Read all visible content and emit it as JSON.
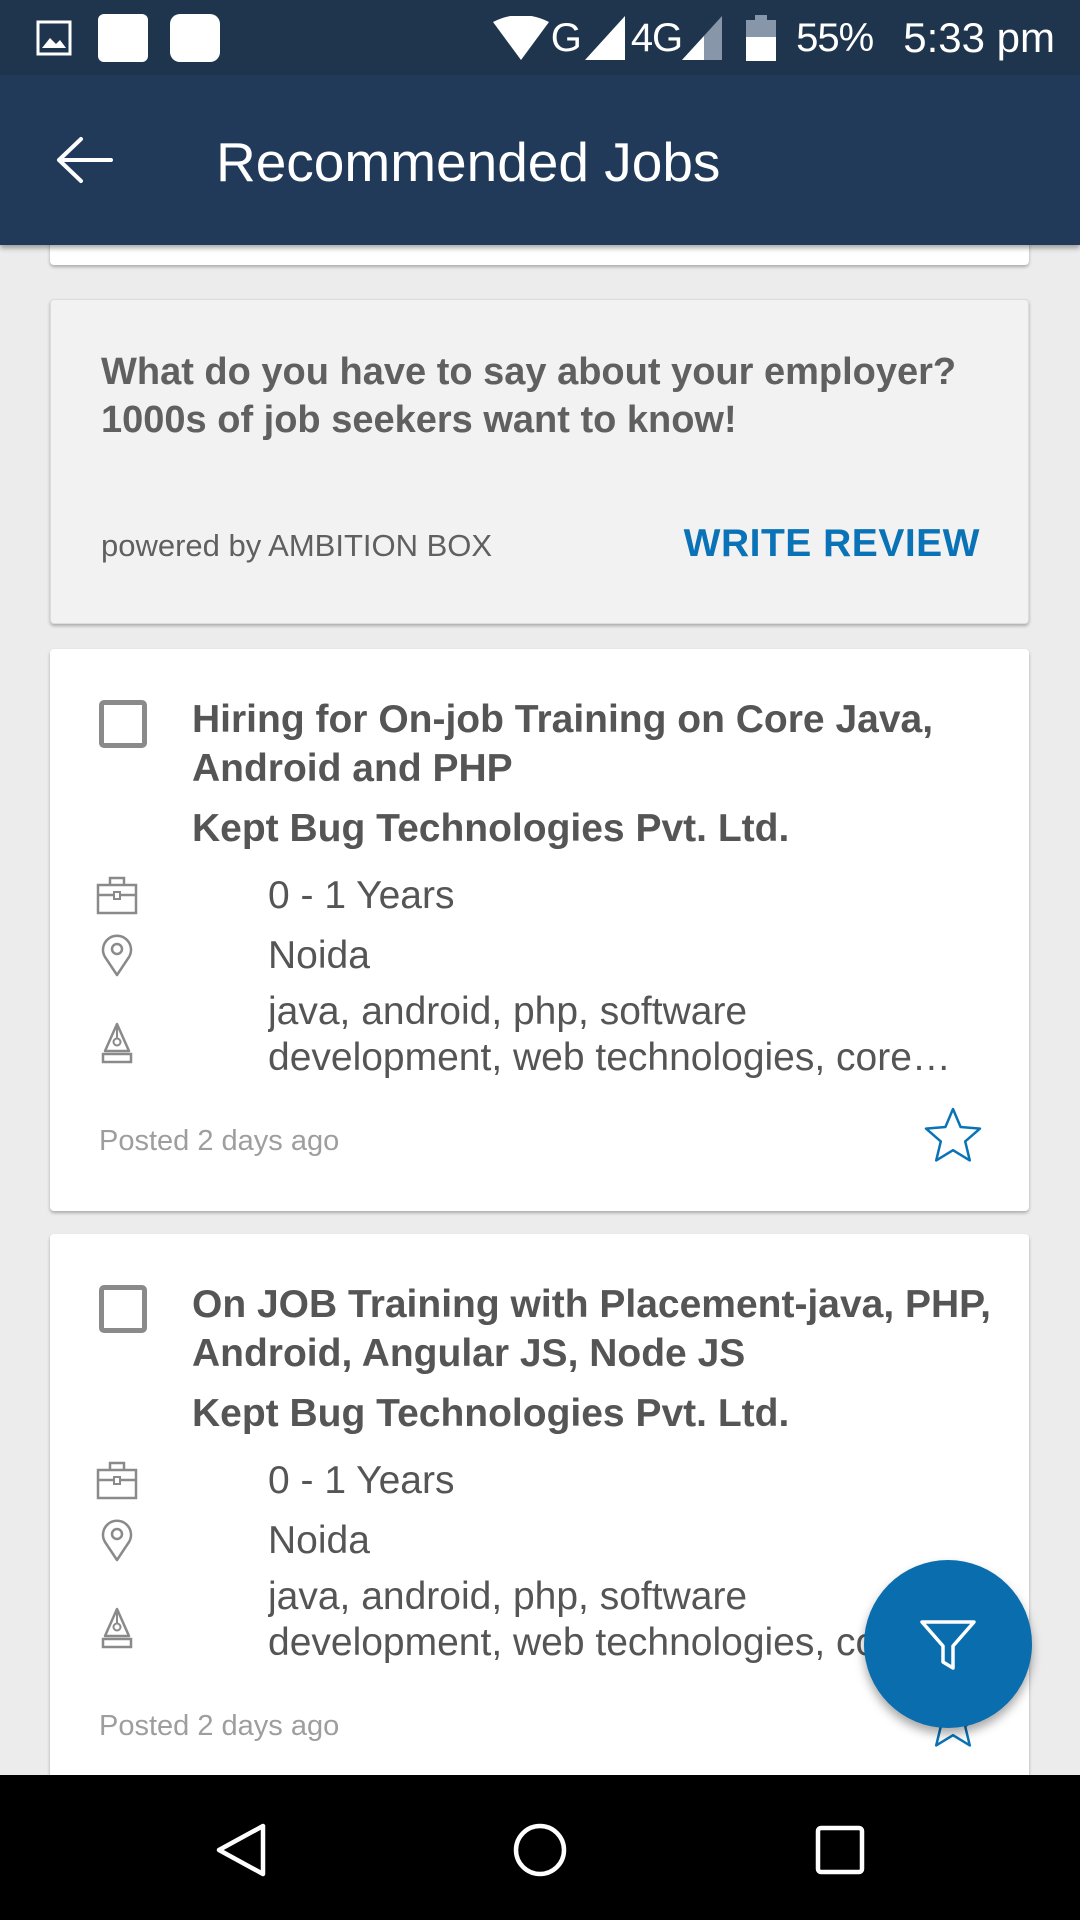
{
  "status_bar": {
    "network_g": "G",
    "network_4g": "4G",
    "battery": "55%",
    "time": "5:33 pm"
  },
  "app_bar": {
    "title": "Recommended Jobs"
  },
  "review_card": {
    "question": "What do you have to say about your employer? 1000s of job seekers want to know!",
    "powered_by": "powered by AMBITION BOX",
    "action_label": "WRITE REVIEW",
    "action_color": "#0a73b7"
  },
  "jobs": [
    {
      "title": "Hiring for On-job Training on Core Java, Android and PHP",
      "company": "Kept Bug Technologies Pvt. Ltd.",
      "experience": "0 - 1 Years",
      "location": "Noida",
      "skills": "java, android, php, software development, web technologies, core…",
      "posted": "Posted 2 days ago",
      "icons": [
        "briefcase-icon",
        "location-pin-icon",
        "skills-pen-icon",
        "star-outline-icon"
      ]
    },
    {
      "title": "On JOB Training with Placement-java, PHP, Android, Angular JS, Node JS",
      "company": "Kept Bug Technologies Pvt. Ltd.",
      "experience": "0 - 1 Years",
      "location": "Noida",
      "skills": "java, android, php, software development, web technologies, co",
      "posted": "Posted 2 days ago",
      "icons": [
        "briefcase-icon",
        "location-pin-icon",
        "skills-pen-icon",
        "star-outline-icon"
      ]
    }
  ],
  "fab": {
    "icon": "filter-icon",
    "color": "#0a6dad"
  },
  "colors": {
    "status_bar": "#1f344d",
    "app_bar": "#213a59",
    "background": "#ececec"
  }
}
